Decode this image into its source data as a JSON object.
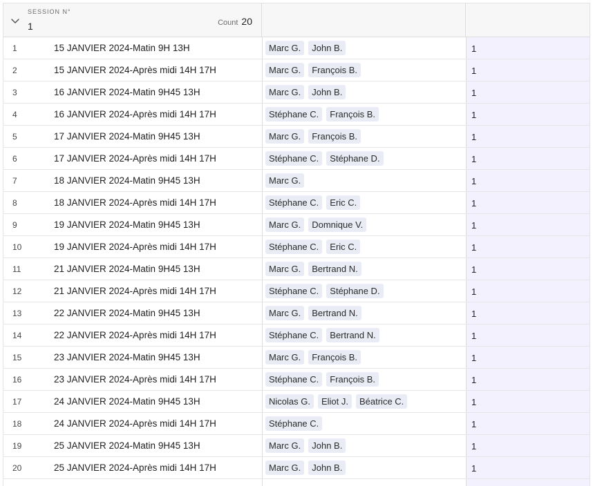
{
  "group": {
    "field_label": "SESSION N°",
    "field_value": "1",
    "count_label": "Count",
    "count_value": "20"
  },
  "rows": [
    {
      "num": "1",
      "session": "15 JANVIER 2024-Matin 9H 13H",
      "trainers": [
        "Marc G.",
        "John B."
      ],
      "count": "1"
    },
    {
      "num": "2",
      "session": "15 JANVIER 2024-Après midi 14H 17H",
      "trainers": [
        "Marc G.",
        "François B."
      ],
      "count": "1"
    },
    {
      "num": "3",
      "session": "16 JANVIER 2024-Matin 9H45 13H",
      "trainers": [
        "Marc G.",
        "John B."
      ],
      "count": "1"
    },
    {
      "num": "4",
      "session": "16 JANVIER 2024-Après midi 14H 17H",
      "trainers": [
        "Stéphane C.",
        "François B."
      ],
      "count": "1"
    },
    {
      "num": "5",
      "session": "17 JANVIER 2024-Matin 9H45 13H",
      "trainers": [
        "Marc G.",
        "François B."
      ],
      "count": "1"
    },
    {
      "num": "6",
      "session": "17 JANVIER 2024-Après midi 14H 17H",
      "trainers": [
        "Stéphane C.",
        "Stéphane D."
      ],
      "count": "1"
    },
    {
      "num": "7",
      "session": "18 JANVIER 2024-Matin 9H45 13H",
      "trainers": [
        "Marc G."
      ],
      "count": "1"
    },
    {
      "num": "8",
      "session": "18 JANVIER 2024-Après midi 14H 17H",
      "trainers": [
        "Stéphane C.",
        "Eric C."
      ],
      "count": "1"
    },
    {
      "num": "9",
      "session": "19 JANVIER 2024-Matin 9H45 13H",
      "trainers": [
        "Marc G.",
        "Domnique V."
      ],
      "count": "1"
    },
    {
      "num": "10",
      "session": "19 JANVIER 2024-Après midi 14H 17H",
      "trainers": [
        "Stéphane C.",
        "Eric C."
      ],
      "count": "1"
    },
    {
      "num": "11",
      "session": "21 JANVIER 2024-Matin 9H45 13H",
      "trainers": [
        "Marc G.",
        "Bertrand N."
      ],
      "count": "1"
    },
    {
      "num": "12",
      "session": "21 JANVIER 2024-Après midi 14H 17H",
      "trainers": [
        "Stéphane C.",
        "Stéphane D."
      ],
      "count": "1"
    },
    {
      "num": "13",
      "session": "22 JANVIER 2024-Matin 9H45 13H",
      "trainers": [
        "Marc G.",
        "Bertrand N."
      ],
      "count": "1"
    },
    {
      "num": "14",
      "session": "22 JANVIER 2024-Après midi 14H 17H",
      "trainers": [
        "Stéphane C.",
        "Bertrand N."
      ],
      "count": "1"
    },
    {
      "num": "15",
      "session": "23 JANVIER 2024-Matin 9H45 13H",
      "trainers": [
        "Marc G.",
        "François B."
      ],
      "count": "1"
    },
    {
      "num": "16",
      "session": "23 JANVIER 2024-Après midi 14H 17H",
      "trainers": [
        "Stéphane C.",
        "François B."
      ],
      "count": "1"
    },
    {
      "num": "17",
      "session": "24 JANVIER 2024-Matin 9H45 13H",
      "trainers": [
        "Nicolas G.",
        "Eliot J.",
        "Béatrice C."
      ],
      "count": "1"
    },
    {
      "num": "18",
      "session": "24 JANVIER 2024-Après midi 14H 17H",
      "trainers": [
        "Stéphane C."
      ],
      "count": "1"
    },
    {
      "num": "19",
      "session": "25 JANVIER 2024-Matin 9H45 13H",
      "trainers": [
        "Marc G.",
        "John B."
      ],
      "count": "1"
    },
    {
      "num": "20",
      "session": "25 JANVIER 2024-Après midi 14H 17H",
      "trainers": [
        "Marc G.",
        "John B."
      ],
      "count": "1"
    }
  ],
  "icons": {
    "collapse": "chevron-down-icon"
  }
}
